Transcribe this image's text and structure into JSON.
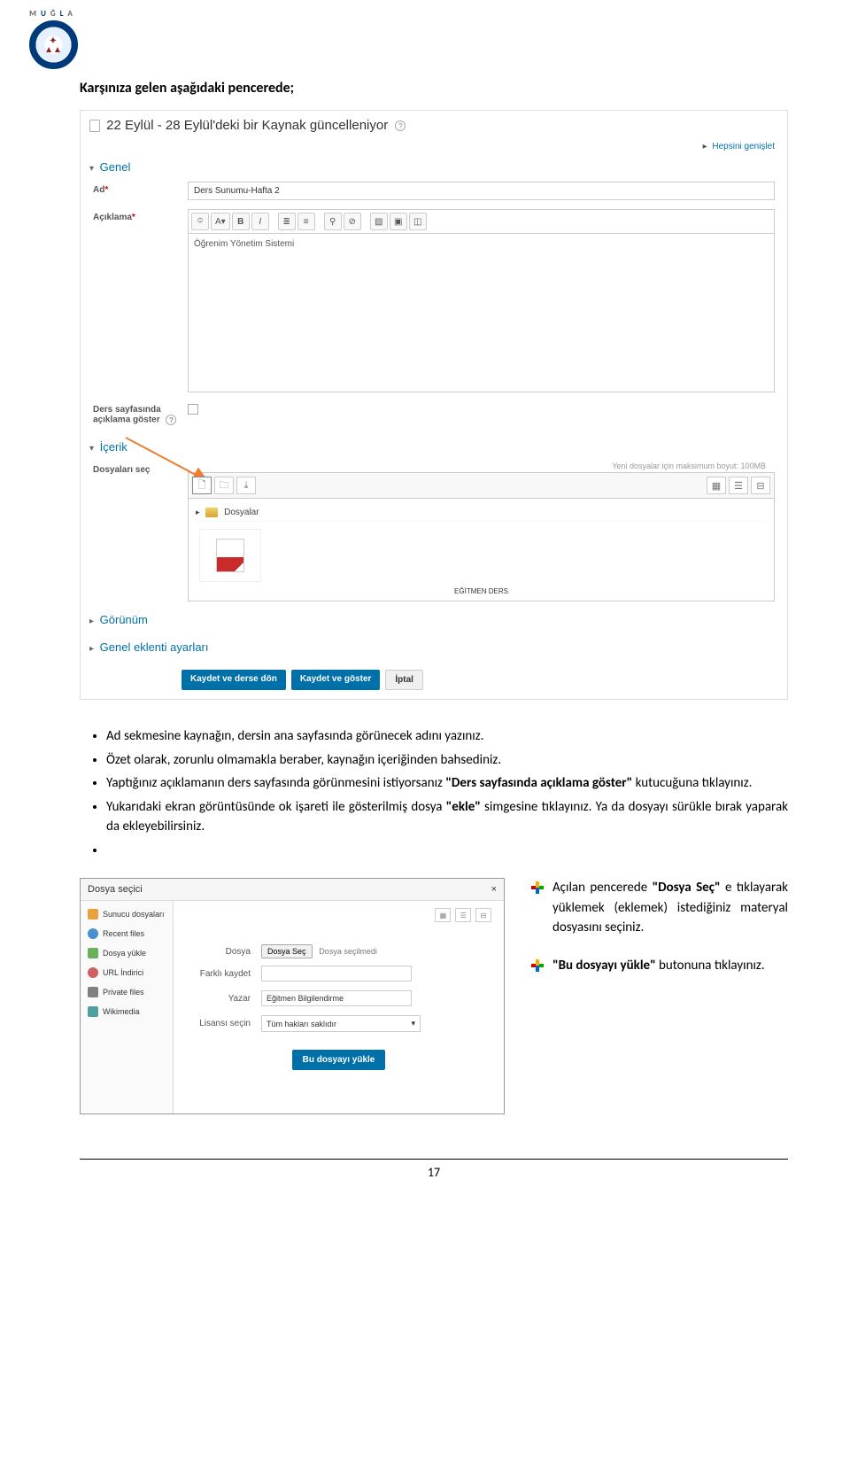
{
  "logo": {
    "line1": "MUĞLA"
  },
  "heading": "Karşınıza gelen aşağıdaki pencerede;",
  "shot1": {
    "title": "22 Eylül - 28 Eylül'deki bir Kaynak güncelleniyor",
    "expand_all": "Hepsini genişlet",
    "sec_general": "Genel",
    "lbl_name": "Ad",
    "name_value": "Ders Sunumu-Hafta 2",
    "lbl_desc": "Açıklama",
    "editor_content": "Öğrenim Yönetim Sistemi",
    "lbl_show": "Ders sayfasında açıklama göster",
    "sec_content": "İçerik",
    "lbl_files": "Dosyaları seç",
    "max_size": "Yeni dosyalar için maksimum boyut: 100MB",
    "folder_label": "Dosyalar",
    "file_label": "EĞİTMEN DERS",
    "sec_view": "Görünüm",
    "sec_plugin": "Genel eklenti ayarları",
    "btn_save_return": "Kaydet ve derse dön",
    "btn_save_show": "Kaydet ve göster",
    "btn_cancel": "İptal",
    "toolbar": {
      "show": "⯐",
      "font": "A▾",
      "bold": "B",
      "italic": "I",
      "ul": "≣",
      "ol": "≡",
      "link": "⚲",
      "unlink": "⊘",
      "img": "▧",
      "media": "▣",
      "html": "◫"
    }
  },
  "bullets": [
    {
      "text": "Ad sekmesine kaynağın, dersin ana sayfasında görünecek adını yazınız."
    },
    {
      "text": "Özet olarak, zorunlu olmamakla beraber, kaynağın içeriğinden bahsediniz."
    },
    {
      "pre": "Yaptığınız açıklamanın ders sayfasında görünmesini istiyorsanız ",
      "bold": "\"Ders sayfasında açıklama göster\"",
      "post": " kutucuğuna tıklayınız."
    },
    {
      "pre": "Yukarıdaki ekran görüntüsünde ok işareti ile gösterilmiş dosya ",
      "bold": "\"ekle\"",
      "post": " simgesine tıklayınız. Ya da dosyayı sürükle bırak yaparak da ekleyebilirsiniz."
    }
  ],
  "shot2": {
    "title": "Dosya seçici",
    "close": "×",
    "side_items": [
      {
        "label": "Sunucu dosyaları",
        "cls": "orange"
      },
      {
        "label": "Recent files",
        "cls": "blue"
      },
      {
        "label": "Dosya yükle",
        "cls": "green"
      },
      {
        "label": "URL İndirici",
        "cls": "red"
      },
      {
        "label": "Private files",
        "cls": "gray"
      },
      {
        "label": "Wikimedia",
        "cls": "teal"
      }
    ],
    "lbl_file": "Dosya",
    "btn_choose": "Dosya Seç",
    "no_file": "Dosya seçilmedi",
    "lbl_saveas": "Farklı kaydet",
    "lbl_author": "Yazar",
    "author_value": "Eğitmen Bilgilendirme",
    "lbl_license": "Lisansı seçin",
    "license_value": "Tüm hakları saklıdır",
    "btn_upload": "Bu dosyayı yükle"
  },
  "notes": [
    {
      "pre": "Açılan pencerede ",
      "bold": "\"Dosya Seç\"",
      "post": " e tıklayarak yüklemek (eklemek) istediğiniz materyal dosyasını seçiniz."
    },
    {
      "pre": "",
      "bold": "\"Bu dosyayı yükle\"",
      "post": " butonuna tıklayınız."
    }
  ],
  "page_number": "17"
}
